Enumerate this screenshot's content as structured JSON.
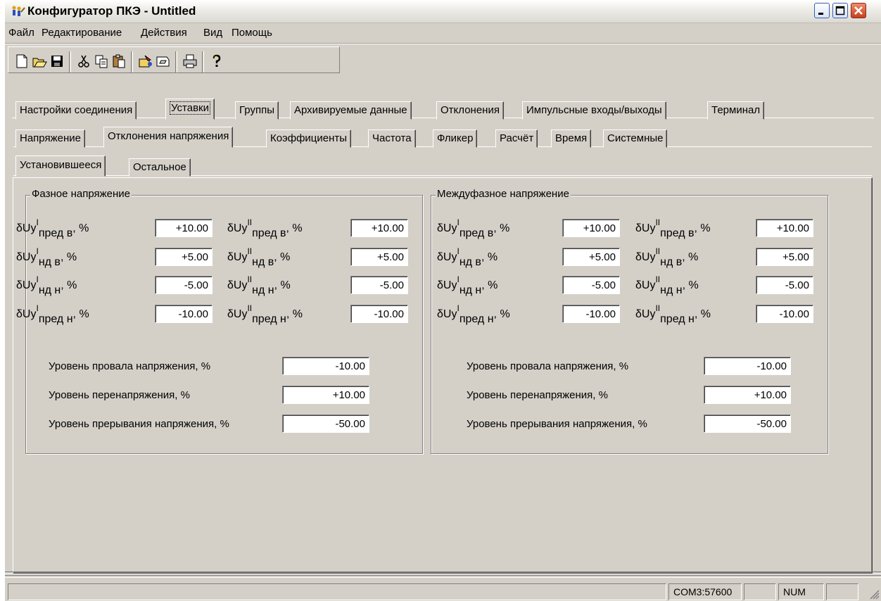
{
  "window": {
    "title": "Конфигуратор ПКЭ - Untitled"
  },
  "menu": [
    "Файл",
    "Редактирование",
    "Действия",
    "Вид",
    "Помощь"
  ],
  "tabs_top": [
    "Настройки соединения",
    "Уставки",
    "Группы",
    "Архивируемые данные",
    "Отклонения",
    "Импульсные входы/выходы",
    "Терминал"
  ],
  "tabs_second": [
    "Напряжение",
    "Отклонения напряжения",
    "Коэффициенты",
    "Частота",
    "Фликер",
    "Расчёт",
    "Время",
    "Системные"
  ],
  "tabs_third": [
    "Установившееся",
    "Остальное"
  ],
  "phase": {
    "title": "Фазное напряжение",
    "rows": [
      {
        "sub": "пред в",
        "v1": "+10.00",
        "v2": "+10.00"
      },
      {
        "sub": "нд в",
        "v1": "+5.00",
        "v2": "+5.00"
      },
      {
        "sub": "нд н",
        "v1": "-5.00",
        "v2": "-5.00"
      },
      {
        "sub": "пред н",
        "v1": "-10.00",
        "v2": "-10.00"
      }
    ],
    "levels": [
      {
        "label": "Уровень провала напряжения, %",
        "value": "-10.00"
      },
      {
        "label": "Уровень перенапряжения, %",
        "value": "+10.00"
      },
      {
        "label": "Уровень прерывания напряжения, %",
        "value": "-50.00"
      }
    ]
  },
  "interphase": {
    "title": "Междуфазное напряжение",
    "rows": [
      {
        "sub": "пред в",
        "v1": "+10.00",
        "v2": "+10.00"
      },
      {
        "sub": "нд в",
        "v1": "+5.00",
        "v2": "+5.00"
      },
      {
        "sub": "нд н",
        "v1": "-5.00",
        "v2": "-5.00"
      },
      {
        "sub": "пред н",
        "v1": "-10.00",
        "v2": "-10.00"
      }
    ],
    "levels": [
      {
        "label": "Уровень провала напряжения, %",
        "value": "-10.00"
      },
      {
        "label": "Уровень перенапряжения, %",
        "value": "+10.00"
      },
      {
        "label": "Уровень прерывания напряжения, %",
        "value": "-50.00"
      }
    ]
  },
  "labels": {
    "prefix": "δUy",
    "sup1": "I",
    "sup2": "II",
    "unit": ", %"
  },
  "status": {
    "port": "COM3:57600",
    "num": "NUM"
  }
}
